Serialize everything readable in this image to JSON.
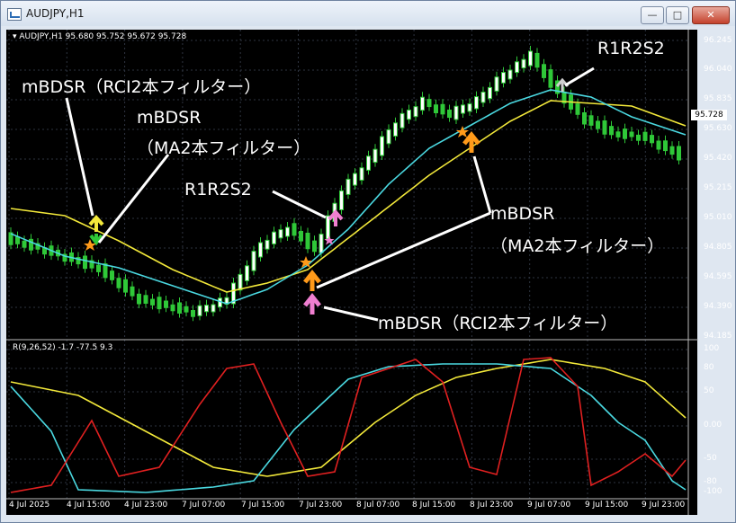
{
  "window": {
    "title": "AUDJPY,H1",
    "min_glyph": "—",
    "max_glyph": "□",
    "close_glyph": "✕",
    "icon": "chart-window-icon"
  },
  "chart": {
    "symbol_header": "▾ AUDJPY,H1  95.680 95.752 95.672 95.728",
    "oscillator_header": "R(9,26,52) -1.7 -77.5 9.3",
    "current_price": "95.728",
    "price_axis": [
      "96.245",
      "96.040",
      "95.835",
      "95.630",
      "95.420",
      "95.215",
      "95.010",
      "94.805",
      "94.595",
      "94.390",
      "94.185"
    ],
    "osc_axis": [
      "100",
      "80",
      "50",
      "0.00",
      "-50",
      "-80",
      "-100"
    ],
    "time_axis": [
      "4 Jul 2025",
      "4 Jul 15:00",
      "4 Jul 23:00",
      "7 Jul 07:00",
      "7 Jul 15:00",
      "7 Jul 23:00",
      "8 Jul 07:00",
      "8 Jul 15:00",
      "8 Jul 23:00",
      "9 Jul 07:00",
      "9 Jul 15:00",
      "9 Jul 23:00"
    ],
    "colors": {
      "background": "#000000",
      "ma_fast": "#4ad8e0",
      "ma_slow": "#f2e83a",
      "rci_short": "#e02020",
      "rci_mid": "#4ad8e0",
      "rci_long": "#f2e83a",
      "candle": "#2fc838",
      "annotation": "#ffffff",
      "arrow_yellow": "#f2e83a",
      "arrow_green": "#2fc838",
      "arrow_orange": "#ff9a1a",
      "arrow_pink": "#f07fd0"
    }
  },
  "annotations": {
    "a1": "mBDSR（RCI2本フィルター）",
    "a2_line1": "mBDSR",
    "a2_line2": "（MA2本フィルター）",
    "a3": "R1R2S2",
    "a4": "R1R2S2",
    "a5_line1": "mBDSR",
    "a5_line2": "（MA2本フィルター）",
    "a6": "mBDSR（RCI2本フィルター）"
  }
}
